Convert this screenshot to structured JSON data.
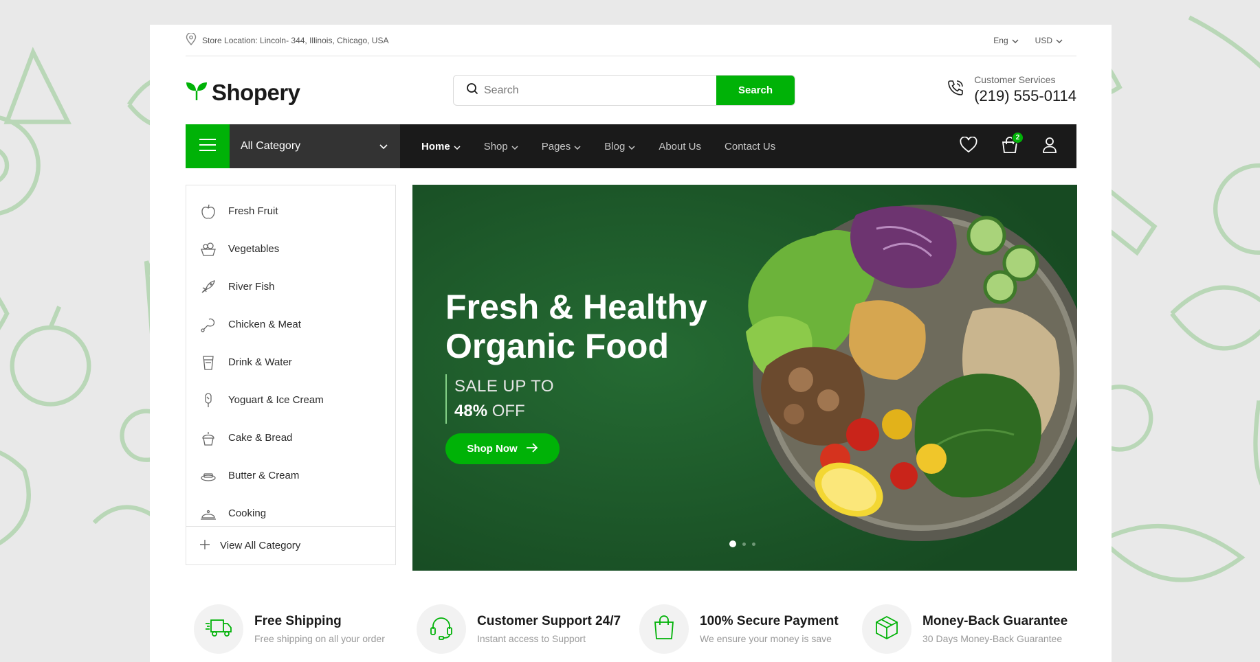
{
  "topbar": {
    "location": "Store Location: Lincoln- 344, Illinois, Chicago, USA",
    "language": "Eng",
    "currency": "USD"
  },
  "header": {
    "logo": "Shopery",
    "search_placeholder": "Search",
    "search_button": "Search",
    "support_label": "Customer Services",
    "support_phone": "(219) 555-0114"
  },
  "nav": {
    "all_category": "All Category",
    "menu": [
      {
        "label": "Home",
        "active": true
      },
      {
        "label": "Shop"
      },
      {
        "label": "Pages"
      },
      {
        "label": "Blog"
      },
      {
        "label": "About Us"
      },
      {
        "label": "Contact Us"
      }
    ],
    "cart_count": "2"
  },
  "sidebar": {
    "categories": [
      {
        "label": "Fresh Fruit",
        "icon": "apple-icon"
      },
      {
        "label": "Vegetables",
        "icon": "vegetable-basket-icon"
      },
      {
        "label": "River Fish",
        "icon": "fish-icon"
      },
      {
        "label": "Chicken & Meat",
        "icon": "chicken-leg-icon"
      },
      {
        "label": "Drink & Water",
        "icon": "cup-icon"
      },
      {
        "label": "Yoguart & Ice Cream",
        "icon": "ice-cream-icon"
      },
      {
        "label": "Cake & Bread",
        "icon": "cupcake-icon"
      },
      {
        "label": "Butter & Cream",
        "icon": "butter-icon"
      },
      {
        "label": "Cooking",
        "icon": "cloche-icon"
      }
    ],
    "view_all": "View All Category"
  },
  "hero": {
    "title_line1": "Fresh & Healthy",
    "title_line2": "Organic Food",
    "sale_line1": "SALE UP TO",
    "sale_percent": "48%",
    "sale_off": "OFF",
    "button": "Shop Now",
    "slides": 3,
    "active_slide": 1
  },
  "features": [
    {
      "title": "Free Shipping",
      "desc": "Free shipping on all your order",
      "icon": "delivery-truck-icon"
    },
    {
      "title": "Customer Support 24/7",
      "desc": "Instant access to Support",
      "icon": "headphones-icon"
    },
    {
      "title": "100% Secure Payment",
      "desc": "We ensure your money is save",
      "icon": "shopping-bag-icon"
    },
    {
      "title": "Money-Back Guarantee",
      "desc": "30 Days Money-Back Guarantee",
      "icon": "package-icon"
    }
  ],
  "colors": {
    "brand_green": "#00b207",
    "nav_dark": "#1a1a1a",
    "hero_green": "#1f5a2b"
  }
}
